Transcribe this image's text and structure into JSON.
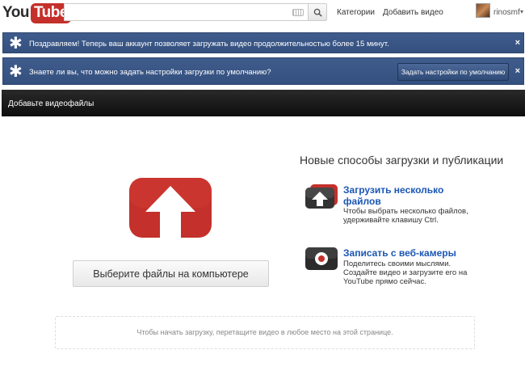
{
  "header": {
    "logo_you": "You",
    "logo_tube": "Tube",
    "search_value": "",
    "nav_categories": "Категории",
    "nav_upload": "Добавить видео",
    "username": "rinosmf",
    "user_caret": "▾"
  },
  "notices": [
    {
      "icon": "star-icon",
      "text": "Поздравляем! Теперь ваш аккаунт позволяет загружать видео продолжительностью более 15 минут.",
      "close": "×"
    },
    {
      "icon": "star-icon",
      "text": "Знаете ли вы, что можно задать настройки загрузки по умолчанию?",
      "button": "Задать настройки по умолчанию",
      "close": "×"
    }
  ],
  "section": {
    "title": "Добавьте видеофайлы"
  },
  "upload": {
    "select_button": "Выберите файлы на компьютере",
    "drop_hint": "Чтобы начать загрузку, перетащите видео в любое место на этой странице."
  },
  "new_ways": {
    "title": "Новые способы загрузки и публикации",
    "items": [
      {
        "icon": "multiple-upload-icon",
        "title": "Загрузить несколько файлов",
        "description": "Чтобы выбрать несколько файлов, удерживайте клавишу Ctrl."
      },
      {
        "icon": "webcam-icon",
        "title": "Записать с веб-камеры",
        "description": "Поделитесь своими мыслями. Создайте видео и загрузите его на YouTube прямо сейчас."
      }
    ]
  },
  "colors": {
    "brand_red": "#c4302b",
    "notice_blue": "#3f5c8c",
    "link_blue": "#1a56b5"
  }
}
